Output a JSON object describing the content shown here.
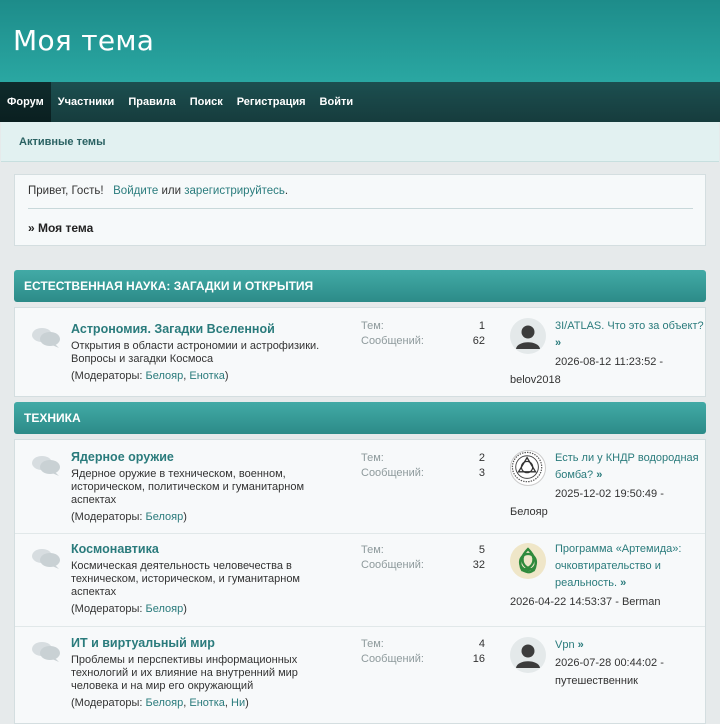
{
  "site": {
    "title": "Моя тема"
  },
  "nav": [
    {
      "label": "Форум"
    },
    {
      "label": "Участники"
    },
    {
      "label": "Правила"
    },
    {
      "label": "Поиск"
    },
    {
      "label": "Регистрация"
    },
    {
      "label": "Войти"
    }
  ],
  "subnav": {
    "active_topics": "Активные темы"
  },
  "welcome": {
    "greeting": "Привет, Гость!",
    "login_link": "Войдите",
    "or": "или",
    "register_link": "зарегистрируйтесь",
    "period": ".",
    "crumb": "» Моя тема"
  },
  "labels": {
    "topics": "Тем:",
    "posts": "Сообщений:",
    "mods_open": "(Модераторы: ",
    "mods_close": ")",
    "comma": ", ",
    "arrow": " »"
  },
  "categories": [
    {
      "name": "Естественная наука: Загадки и открытия",
      "forums": [
        {
          "title": "Астрономия. Загадки Вселенной",
          "desc": "Открытия в области астрономии и астрофизики. Вопросы и загадки Космоса",
          "mods": [
            "Белояр",
            "Енотка"
          ],
          "topics": "1",
          "posts": "62",
          "last_post": {
            "title": "3I/ATLAS. Что это за объект?",
            "date": "2026-08-12 11:23:52",
            "author": "belov2018",
            "avatar": "default-user-avatar"
          }
        }
      ]
    },
    {
      "name": "Техника",
      "forums": [
        {
          "title": "Ядерное оружие",
          "desc": "Ядерное оружие в техническом, военном, историческом, политическом и гуманитарном аспектах",
          "mods": [
            "Белояр"
          ],
          "topics": "2",
          "posts": "3",
          "last_post": {
            "title": "Есть ли у КНДР водородная бомба?",
            "date": "2025-12-02 19:50:49",
            "author": "Белояр",
            "avatar": "celtic-knot-emblem-avatar"
          }
        },
        {
          "title": "Космонавтика",
          "desc": "Космическая деятельность человечества в техническом, историческом, и гуманитарном аспектах",
          "mods": [
            "Белояр"
          ],
          "topics": "5",
          "posts": "32",
          "last_post": {
            "title": "Программа «Артемида»: очковтирательство и реальность.",
            "date": "2026-04-22 14:53:37",
            "author": "Berman",
            "avatar": "green-triquetra-avatar"
          }
        },
        {
          "title": "ИТ и виртуальный мир",
          "desc": "Проблемы и перспективы информационных технологий и их влияние на внутренний мир человека и на мир его окружающий",
          "mods": [
            "Белояр",
            "Енотка",
            "Ни"
          ],
          "topics": "4",
          "posts": "16",
          "last_post": {
            "title": "Vpn",
            "date": "2026-07-28 00:44:02",
            "author": "путешественник",
            "avatar": "default-user-avatar"
          }
        }
      ]
    }
  ],
  "colors": {
    "header": "#2aa7a2",
    "navbar": "#163c3d",
    "category": "#2c8b88",
    "link": "#2a7b7c"
  }
}
